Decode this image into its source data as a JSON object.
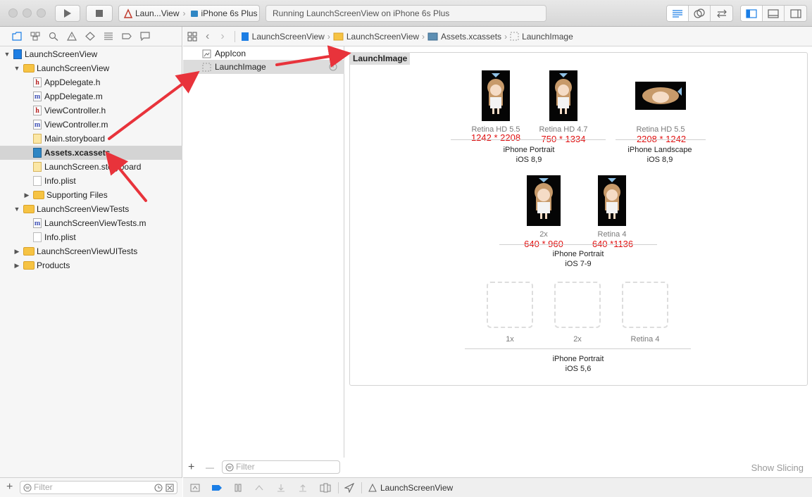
{
  "colors": {
    "accent": "#1a7ee6",
    "annotation_red": "#e8333b",
    "selection": "#d4d4d4"
  },
  "toolbar": {
    "scheme_target": "Laun...View",
    "device": "iPhone 6s Plus",
    "status": "Running LaunchScreenView on iPhone 6s Plus",
    "icons": [
      "run-icon",
      "stop-icon",
      "standard-editor-icon",
      "assistant-editor-icon",
      "version-editor-icon",
      "navigator-toggle-icon",
      "debug-toggle-icon",
      "utilities-toggle-icon"
    ]
  },
  "navigator": {
    "tabs": [
      "folder-icon",
      "symbol-icon",
      "search-icon",
      "warning-icon",
      "test-icon",
      "debug-icon",
      "breakpoint-icon",
      "report-icon"
    ],
    "items": [
      {
        "label": "LaunchScreenView",
        "kind": "proj",
        "expanded": true
      },
      {
        "label": "LaunchScreenView",
        "kind": "folder",
        "expanded": true
      },
      {
        "label": "AppDelegate.h",
        "kind": "h"
      },
      {
        "label": "AppDelegate.m",
        "kind": "m"
      },
      {
        "label": "ViewController.h",
        "kind": "h"
      },
      {
        "label": "ViewController.m",
        "kind": "m"
      },
      {
        "label": "Main.storyboard",
        "kind": "sb"
      },
      {
        "label": "Assets.xcassets",
        "kind": "xc",
        "selected": true
      },
      {
        "label": "LaunchScreen.storyboard",
        "kind": "sb"
      },
      {
        "label": "Info.plist",
        "kind": "pl"
      },
      {
        "label": "Supporting Files",
        "kind": "folder",
        "expanded": false
      },
      {
        "label": "LaunchScreenViewTests",
        "kind": "folder",
        "expanded": true
      },
      {
        "label": "LaunchScreenViewTests.m",
        "kind": "m"
      },
      {
        "label": "Info.plist",
        "kind": "pl"
      },
      {
        "label": "LaunchScreenViewUITests",
        "kind": "folder",
        "expanded": false
      },
      {
        "label": "Products",
        "kind": "folder",
        "expanded": false
      }
    ],
    "filter_placeholder": "Filter"
  },
  "jumpbar": {
    "crumbs": [
      "LaunchScreenView",
      "LaunchScreenView",
      "Assets.xcassets",
      "LaunchImage"
    ]
  },
  "assets": {
    "items": [
      {
        "label": "AppIcon",
        "selected": false
      },
      {
        "label": "LaunchImage",
        "selected": true
      }
    ],
    "filter_placeholder": "Filter",
    "add": "+",
    "remove": "—"
  },
  "editor": {
    "set_title": "LaunchImage",
    "row1": {
      "slots": [
        {
          "label": "Retina HD 5.5",
          "size": "1242 * 2208"
        },
        {
          "label": "Retina HD 4.7",
          "size": "750 * 1334"
        },
        {
          "label": "Retina HD 5.5",
          "size": "2208 * 1242"
        }
      ],
      "group_a": {
        "line1": "iPhone Portrait",
        "line2": "iOS 8,9"
      },
      "group_b": {
        "line1": "iPhone Landscape",
        "line2": "iOS 8,9"
      }
    },
    "row2": {
      "slots": [
        {
          "label": "2x",
          "size": "640 * 960"
        },
        {
          "label": "Retina 4",
          "size": "640 *1136"
        }
      ],
      "group": {
        "line1": "iPhone Portrait",
        "line2": "iOS 7-9"
      }
    },
    "row3": {
      "slots": [
        {
          "label": "1x"
        },
        {
          "label": "2x"
        },
        {
          "label": "Retina 4"
        }
      ],
      "group": {
        "line1": "iPhone Portrait",
        "line2": "iOS 5,6"
      }
    },
    "show_slicing": "Show Slicing"
  },
  "debugbar": {
    "target": "LaunchScreenView"
  }
}
